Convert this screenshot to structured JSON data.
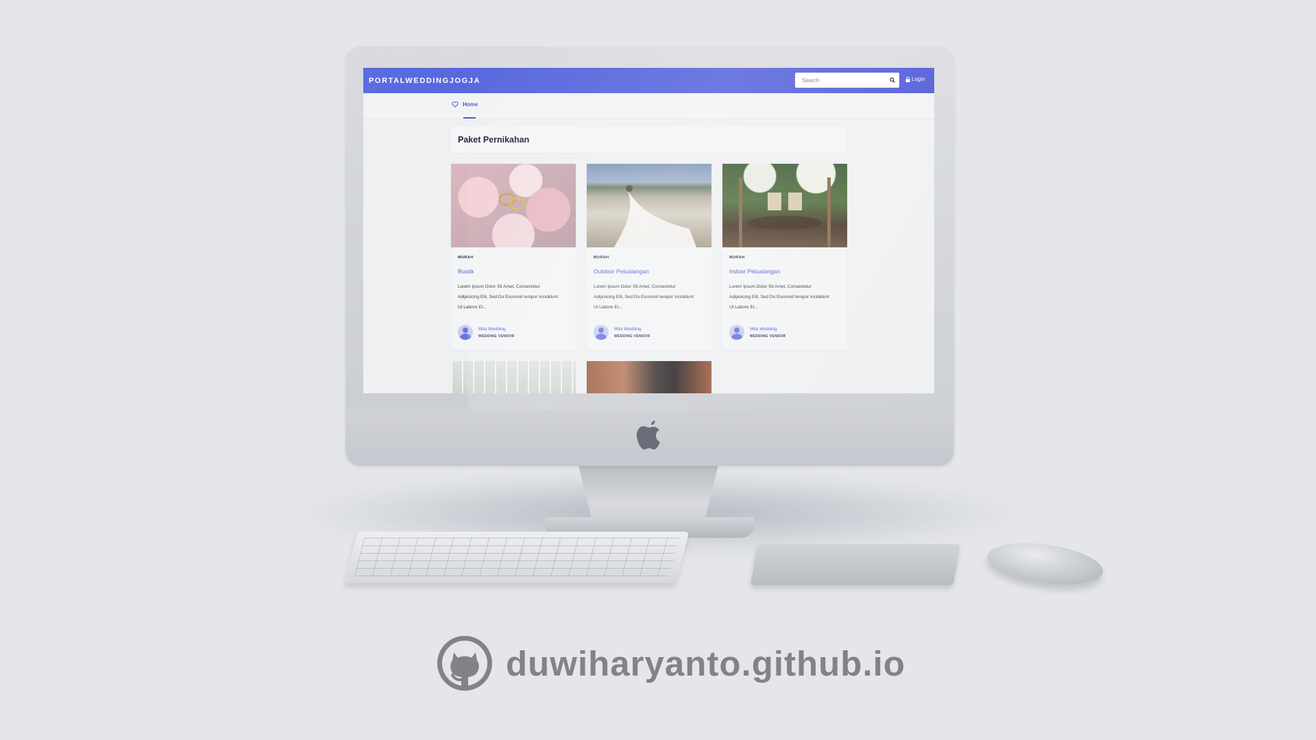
{
  "site": {
    "brand": "PORTALWEDDINGJOGJA",
    "search_placeholder": "Search",
    "login_label": "Login"
  },
  "nav": {
    "home_label": "Home"
  },
  "section": {
    "title": "Paket Pernikahan"
  },
  "cards": [
    {
      "category": "MURAH",
      "title": "Rustik",
      "description": "Lorem Ipsum Dolor Sit Amet, Consectetur Adipisicing Elit, Sed Do Eiusmod tempor Incididunt Ut Labore Et...",
      "author_name": "Mita Wedding",
      "author_role": "WEDDING VENDOR"
    },
    {
      "category": "MURAH",
      "title": "Outdoor Petualangan",
      "description": "Lorem Ipsum Dolor Sit Amet, Consectetur Adipisicing Elit, Sed Do Eiusmod tempor Incididunt Ut Labore Et...",
      "author_name": "Mita Wedding",
      "author_role": "WEDDING VENDOR"
    },
    {
      "category": "MURAH",
      "title": "Indoor Petualangan",
      "description": "Lorem Ipsum Dolor Sit Amet, Consectetur Adipisicing Elit, Sed Do Eiusmod tempor Incididunt Ut Labore Et...",
      "author_name": "Mita Wedding",
      "author_role": "WEDDING VENDOR"
    }
  ],
  "footer": {
    "text": "duwiharyanto.github.io",
    "icon": "github-icon"
  },
  "colors": {
    "primary": "#4b58d8",
    "background": "#e4e6ea",
    "footer_text": "#828387"
  }
}
